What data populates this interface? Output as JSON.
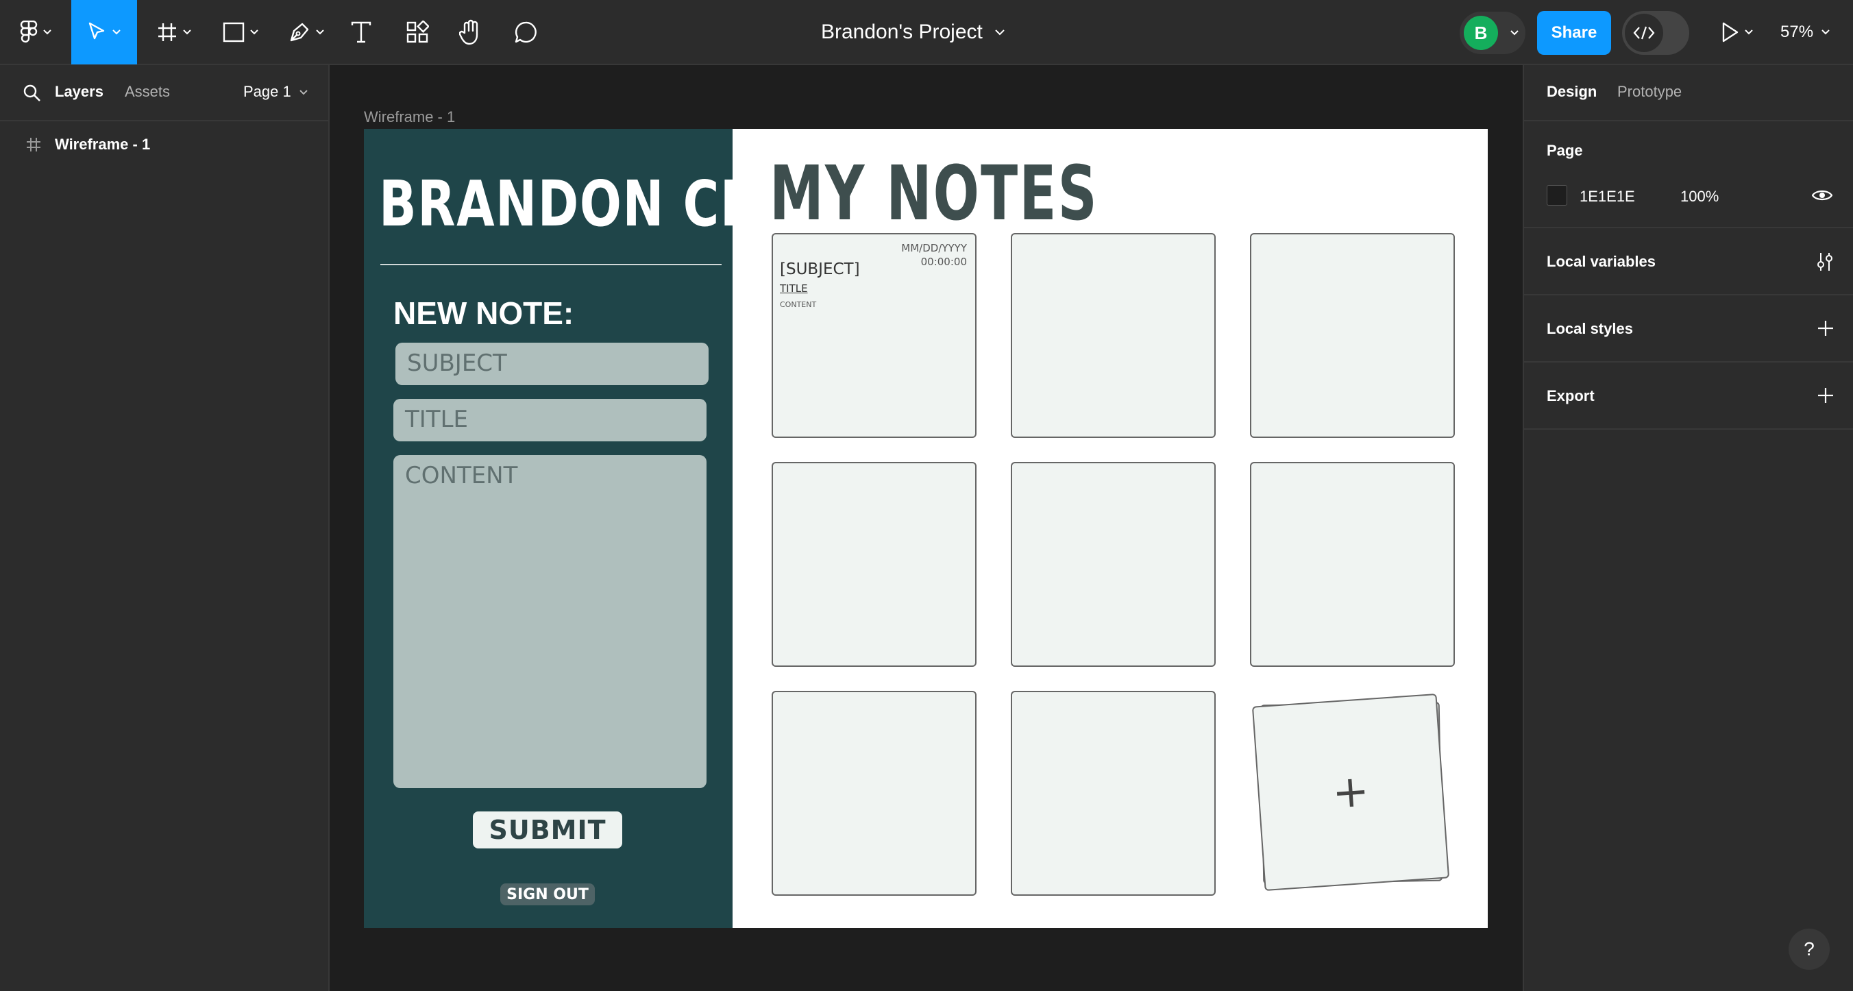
{
  "toolbar": {
    "project_title": "Brandon's Project",
    "avatar_initial": "B",
    "share_label": "Share",
    "zoom": "57%",
    "accent_color": "#0d99ff"
  },
  "left_panel": {
    "tabs": [
      "Layers",
      "Assets"
    ],
    "page_selector": "Page 1",
    "layers": [
      {
        "label": "Wireframe - 1",
        "icon": "frame-icon"
      }
    ]
  },
  "right_panel": {
    "tabs": [
      "Design",
      "Prototype"
    ],
    "page_section": {
      "title": "Page",
      "color_hex": "1E1E1E",
      "opacity": "100%"
    },
    "sections": [
      "Local variables",
      "Local styles",
      "Export"
    ]
  },
  "canvas": {
    "frame_label": "Wireframe - 1",
    "sidebar": {
      "name": "BRANDON CHIN",
      "new_note_heading": "NEW NOTE:",
      "subject_placeholder": "SUBJECT",
      "title_placeholder": "TITLE",
      "content_placeholder": "CONTENT",
      "submit_label": "SUBMIT",
      "signout_label": "SIGN OUT",
      "background": "#1f4549"
    },
    "notes_heading": "MY NOTES",
    "sample_note": {
      "date": "MM/DD/YYYY",
      "time": "00:00:00",
      "subject": "[SUBJECT]",
      "title": "TITLE",
      "content": "CONTENT"
    },
    "add_card_symbol": "+"
  },
  "help_label": "?"
}
